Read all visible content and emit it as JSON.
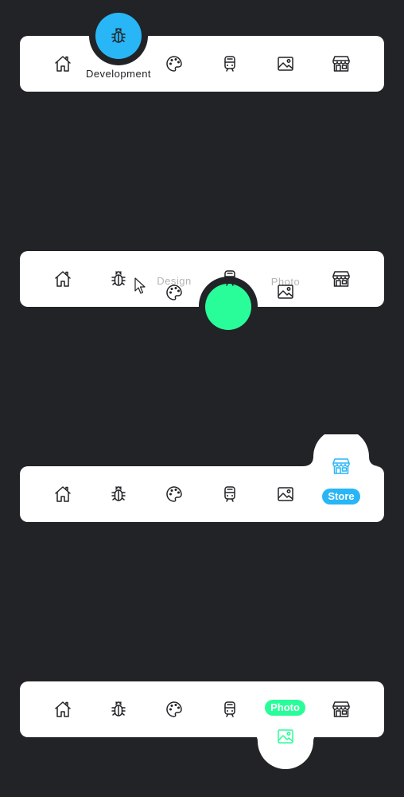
{
  "colors": {
    "background": "#222327",
    "bar": "#ffffff",
    "accent_blue": "#29b6f6",
    "accent_green": "#29fd9a",
    "icon": "#222327",
    "faded_label": "#b5b5b5"
  },
  "nav_items": [
    {
      "icon": "home-icon"
    },
    {
      "icon": "bug-icon"
    },
    {
      "icon": "palette-icon"
    },
    {
      "icon": "train-icon"
    },
    {
      "icon": "image-icon"
    },
    {
      "icon": "store-icon"
    }
  ],
  "variant1": {
    "active_label": "Development"
  },
  "variant2": {
    "label_design": "Design",
    "label_photo": "Photo"
  },
  "variant3": {
    "active_label": "Store"
  },
  "variant4": {
    "active_label": "Photo"
  }
}
